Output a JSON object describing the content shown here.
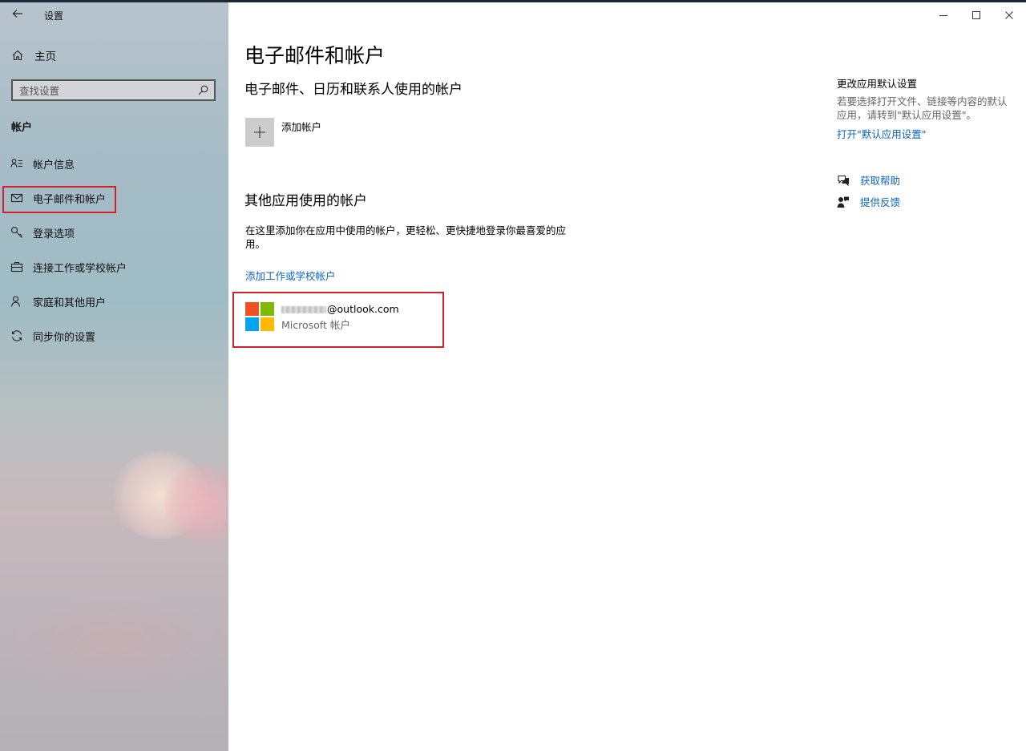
{
  "window": {
    "title": "设置",
    "controls": {
      "minimize_icon": "minimize-icon",
      "maximize_icon": "maximize-icon",
      "close_icon": "close-icon"
    }
  },
  "sidebar": {
    "home_label": "主页",
    "search_placeholder": "查找设置",
    "section_title": "帐户",
    "items": [
      {
        "label": "帐户信息",
        "icon": "account-info-icon"
      },
      {
        "label": "电子邮件和帐户",
        "icon": "mail-icon",
        "selected": true
      },
      {
        "label": "登录选项",
        "icon": "key-icon"
      },
      {
        "label": "连接工作或学校帐户",
        "icon": "briefcase-icon"
      },
      {
        "label": "家庭和其他用户",
        "icon": "person-icon"
      },
      {
        "label": "同步你的设置",
        "icon": "sync-icon"
      }
    ]
  },
  "main": {
    "title": "电子邮件和帐户",
    "email_section_title": "电子邮件、日历和联系人使用的帐户",
    "add_account_label": "添加帐户",
    "other_section_title": "其他应用使用的帐户",
    "other_description": "在这里添加你在应用中使用的帐户，更轻松、更快捷地登录你最喜爱的应用。",
    "add_work_link": "添加工作或学校帐户",
    "account": {
      "email_suffix": "@outlook.com",
      "type": "Microsoft 帐户",
      "logo_colors": [
        "#f25022",
        "#7fba00",
        "#00a4ef",
        "#ffb900"
      ]
    }
  },
  "right_column": {
    "default_apps_title": "更改应用默认设置",
    "default_apps_desc": "若要选择打开文件、链接等内容的默认应用，请转到\"默认应用设置\"。",
    "default_apps_link": "打开\"默认应用设置\"",
    "get_help": "获取帮助",
    "feedback": "提供反馈"
  },
  "colors": {
    "accent_link": "#0a64c4",
    "highlight_box": "#d0202c"
  }
}
